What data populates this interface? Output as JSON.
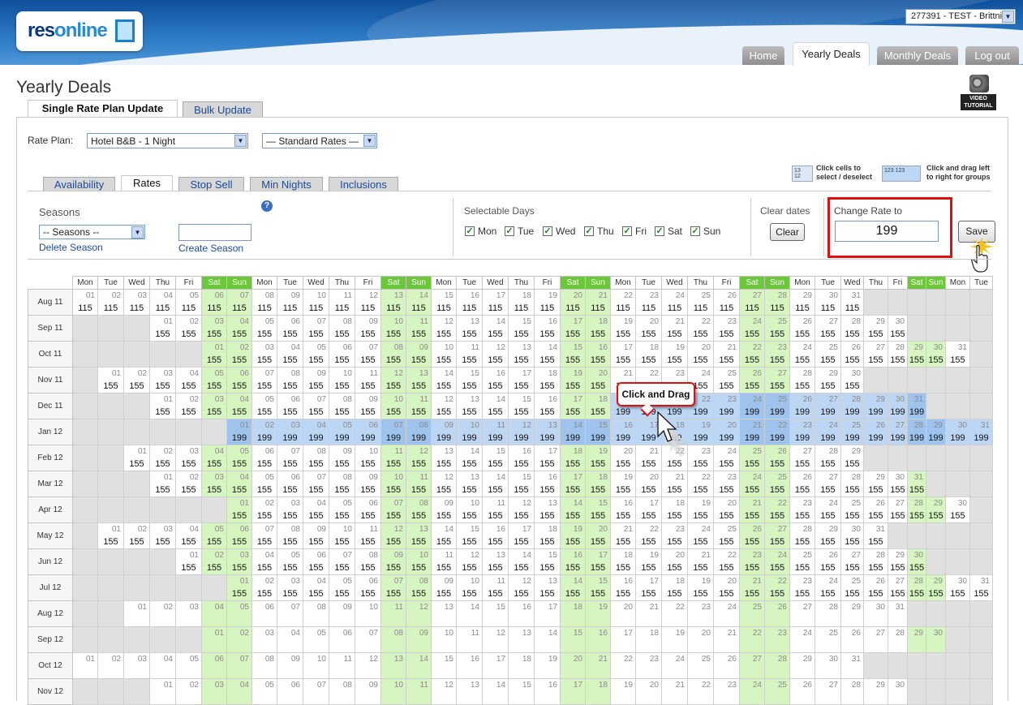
{
  "header": {
    "logo_text_a": "res",
    "logo_text_b": "online",
    "account_selector": "277391 - TEST - Brittni",
    "nav_tabs": [
      {
        "label": "Home",
        "active": false
      },
      {
        "label": "Yearly Deals",
        "active": true
      },
      {
        "label": "Monthly Deals",
        "active": false
      },
      {
        "label": "Log out",
        "active": false
      }
    ]
  },
  "page": {
    "title": "Yearly Deals",
    "video_tutorial_label": "VIDEO TUTORIAL",
    "subtabs": [
      {
        "label": "Single Rate Plan Update",
        "active": true
      },
      {
        "label": "Bulk Update",
        "active": false
      }
    ],
    "rate_plan_label": "Rate Plan:",
    "rate_plan_value": "Hotel B&B - 1 Night",
    "rate_type_value": "— Standard Rates —",
    "hints": {
      "hint1": "Click cells to select / deselect",
      "hint2": "Click and drag left to right for groups"
    },
    "tool_tabs": [
      {
        "label": "Availability",
        "active": false
      },
      {
        "label": "Rates",
        "active": true
      },
      {
        "label": "Stop Sell",
        "active": false
      },
      {
        "label": "Min Nights",
        "active": false
      },
      {
        "label": "Inclusions",
        "active": false
      }
    ],
    "seasons": {
      "heading": "Seasons",
      "select_value": "-- Seasons --",
      "delete_link": "Delete Season",
      "create_link": "Create Season",
      "new_season_value": ""
    },
    "selectable_days": {
      "heading": "Selectable Days",
      "days": [
        {
          "label": "Mon",
          "checked": true
        },
        {
          "label": "Tue",
          "checked": true
        },
        {
          "label": "Wed",
          "checked": true
        },
        {
          "label": "Thu",
          "checked": true
        },
        {
          "label": "Fri",
          "checked": true
        },
        {
          "label": "Sat",
          "checked": true
        },
        {
          "label": "Sun",
          "checked": true
        }
      ]
    },
    "clear_dates": {
      "heading": "Clear dates",
      "button": "Clear"
    },
    "change_rate": {
      "heading": "Change Rate to",
      "value": "199",
      "save_button": "Save"
    },
    "callout": "Click and Drag"
  },
  "calendar": {
    "day_headers": [
      "Mon",
      "Tue",
      "Wed",
      "Thu",
      "Fri",
      "Sat",
      "Sun",
      "Mon",
      "Tue",
      "Wed",
      "Thu",
      "Fri",
      "Sat",
      "Sun",
      "Mon",
      "Tue",
      "Wed",
      "Thu",
      "Fri",
      "Sat",
      "Sun",
      "Mon",
      "Tue",
      "Wed",
      "Thu",
      "Fri",
      "Sat",
      "Sun",
      "Mon",
      "Tue",
      "Wed",
      "Thu",
      "Fri",
      "Sat",
      "Sun",
      "Mon",
      "Tue"
    ],
    "months": [
      {
        "label": "Aug 11",
        "start": 0,
        "days": 31,
        "rates": "115",
        "firstRow": true
      },
      {
        "label": "Sep 11",
        "start": 3,
        "days": 30,
        "rates": "155"
      },
      {
        "label": "Oct 11",
        "start": 5,
        "days": 31,
        "rates": "155"
      },
      {
        "label": "Nov 11",
        "start": 1,
        "days": 30,
        "rates": "155"
      },
      {
        "label": "Dec 11",
        "start": 3,
        "days": 31,
        "rates": "155",
        "selectedFrom": 19,
        "selectedRate": "199"
      },
      {
        "label": "Jan 12",
        "start": 6,
        "days": 31,
        "rates": "199",
        "allSelected": true
      },
      {
        "label": "Feb 12",
        "start": 2,
        "days": 29,
        "rates": "155"
      },
      {
        "label": "Mar 12",
        "start": 3,
        "days": 31,
        "rates": "155"
      },
      {
        "label": "Apr 12",
        "start": 6,
        "days": 30,
        "rates": "155"
      },
      {
        "label": "May 12",
        "start": 1,
        "days": 31,
        "rates": "155"
      },
      {
        "label": "Jun 12",
        "start": 4,
        "days": 30,
        "rates": "155"
      },
      {
        "label": "Jul 12",
        "start": 6,
        "days": 31,
        "rates": "155"
      },
      {
        "label": "Aug 12",
        "start": 2,
        "days": 31,
        "rates": ""
      },
      {
        "label": "Sep 12",
        "start": 5,
        "days": 30,
        "rates": ""
      },
      {
        "label": "Oct 12",
        "start": 0,
        "days": 31,
        "rates": ""
      },
      {
        "label": "Nov 12",
        "start": 3,
        "days": 30,
        "rates": ""
      }
    ]
  },
  "colors": {
    "weekend_header": "#6cc83a",
    "weekend_cell": "#d6f5c0",
    "selected_cell": "#bcd6f3",
    "highlight_border": "#e01010"
  }
}
